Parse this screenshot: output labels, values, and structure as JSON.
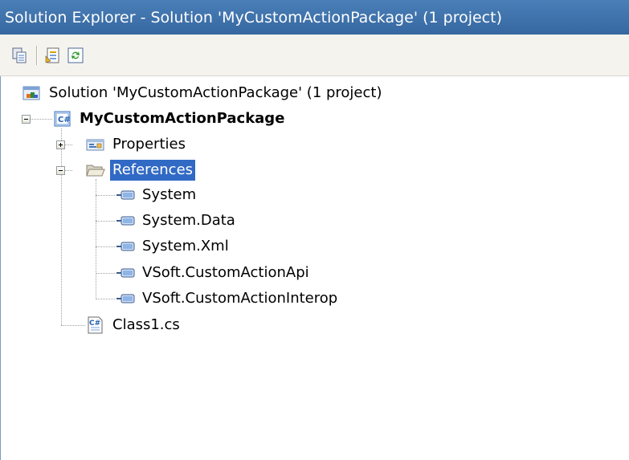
{
  "window": {
    "title": "Solution Explorer - Solution 'MyCustomActionPackage' (1 project)"
  },
  "toolbar": {
    "buttons": [
      {
        "icon": "show-all-files-icon"
      },
      {
        "icon": "properties-icon"
      },
      {
        "icon": "refresh-icon"
      }
    ]
  },
  "tree": {
    "solution": {
      "label": "Solution 'MyCustomActionPackage' (1 project)",
      "icon": "solution-icon"
    },
    "project": {
      "label": "MyCustomActionPackage",
      "icon": "csharp-project-icon",
      "expanded": true
    },
    "properties": {
      "label": "Properties",
      "icon": "properties-folder-icon",
      "expanded": false
    },
    "references": {
      "label": "References",
      "icon": "open-folder-icon",
      "expanded": true,
      "selected": true,
      "items": [
        {
          "label": "System",
          "icon": "reference-icon"
        },
        {
          "label": "System.Data",
          "icon": "reference-icon"
        },
        {
          "label": "System.Xml",
          "icon": "reference-icon"
        },
        {
          "label": "VSoft.CustomActionApi",
          "icon": "reference-icon"
        },
        {
          "label": "VSoft.CustomActionInterop",
          "icon": "reference-icon"
        }
      ]
    },
    "class_file": {
      "label": "Class1.cs",
      "icon": "csharp-file-icon"
    }
  },
  "colors": {
    "titlebar": "#3a6ea5",
    "selection": "#316ac5",
    "toolbar": "#f4f3ee"
  }
}
